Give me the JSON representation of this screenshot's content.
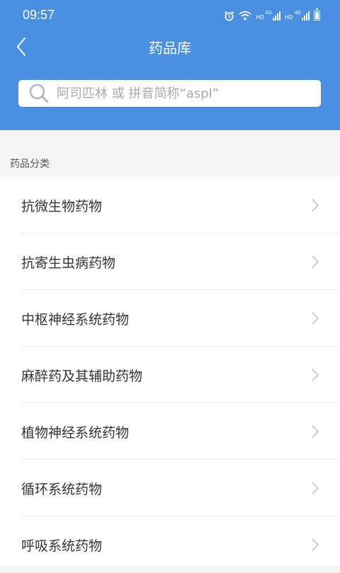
{
  "status_bar": {
    "time": "09:57",
    "icons": [
      "alarm-icon",
      "wifi-icon",
      "hd-5g-signal-icon",
      "hd-4g-signal-icon",
      "battery-icon"
    ],
    "hd1": "HD",
    "net1": "5G",
    "hd2": "HD",
    "net2": "4G"
  },
  "header": {
    "title": "药品库",
    "back_icon": "chevron-left-icon",
    "color": "#4a90e2"
  },
  "search": {
    "placeholder": "阿司匹林 或 拼音简称“aspl”",
    "value": "",
    "icon": "search-icon"
  },
  "section": {
    "label": "药品分类"
  },
  "categories": [
    {
      "label": "抗微生物药物"
    },
    {
      "label": "抗寄生虫病药物"
    },
    {
      "label": "中枢神经系统药物"
    },
    {
      "label": "麻醉药及其辅助药物"
    },
    {
      "label": "植物神经系统药物"
    },
    {
      "label": "循环系统药物"
    },
    {
      "label": "呼吸系统药物"
    }
  ]
}
